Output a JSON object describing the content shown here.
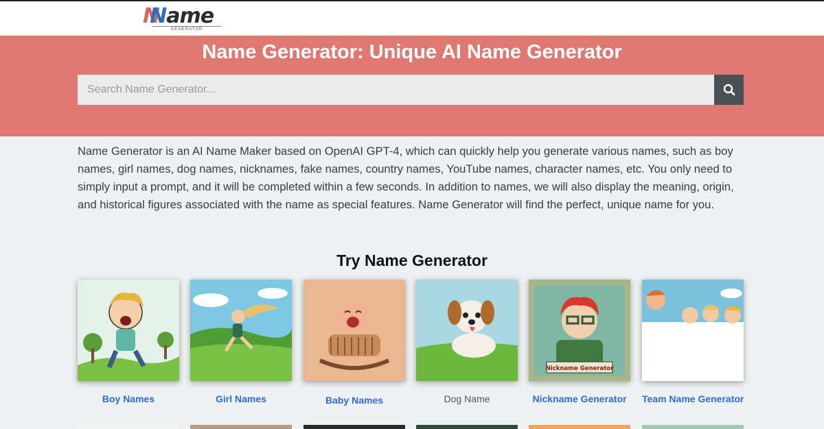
{
  "logo": {
    "word_n": "N",
    "word_rest": "ame",
    "sub": "GENERATOR"
  },
  "hero": {
    "title": "Name Generator: Unique AI Name Generator",
    "search_placeholder": "Search Name Generator..."
  },
  "intro": "Name Generator is an AI Name Maker based on OpenAI GPT-4, which can quickly help you generate various names, such as boy names, girl names, dog names, nicknames, fake names, country names, YouTube names, character names, etc. You only need to simply input a prompt, and it will be completed within a few seconds. In addition to names, we will also display the meaning, origin, and historical figures associated with the name as special features. Name Generator will find the perfect, unique name for you.",
  "section": {
    "title": "Try Name Generator"
  },
  "cards": [
    {
      "label": "Boy Names"
    },
    {
      "label": "Girl Names"
    },
    {
      "label": "Baby Names"
    },
    {
      "label": "Dog Name"
    },
    {
      "label": "Nickname Generator",
      "badge": "Nickname Generator"
    },
    {
      "label": "Team Name Generator"
    }
  ],
  "colors": {
    "hero_bg": "#df7873",
    "link": "#2d6bd6",
    "search_button": "#4a5156",
    "page_bg": "#eef1f1"
  },
  "icons": {
    "search": "search-icon"
  }
}
